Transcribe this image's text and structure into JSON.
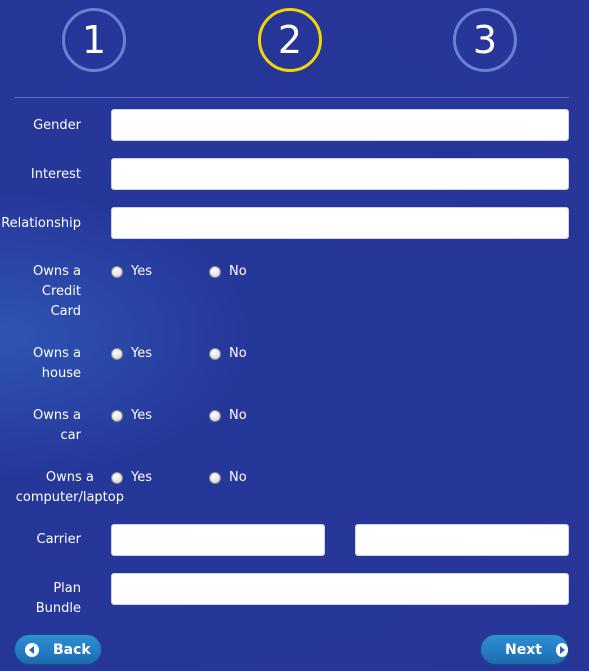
{
  "steps": [
    {
      "label": "1",
      "active": false
    },
    {
      "label": "2",
      "active": true
    },
    {
      "label": "3",
      "active": false
    }
  ],
  "colors": {
    "background": "#273597",
    "active_step": "#f2d600",
    "button": "#1c6bb0"
  },
  "form": {
    "gender": {
      "label": "Gender",
      "value": ""
    },
    "interest": {
      "label": "Interest",
      "value": ""
    },
    "relationship": {
      "label": "Relationship",
      "value": ""
    },
    "credit_card": {
      "label_lines": [
        "Owns a",
        "Credit",
        "Card"
      ],
      "yes": "Yes",
      "no": "No"
    },
    "house": {
      "label_lines": [
        "Owns a",
        "house"
      ],
      "yes": "Yes",
      "no": "No"
    },
    "car": {
      "label_lines": [
        "Owns a",
        "car"
      ],
      "yes": "Yes",
      "no": "No"
    },
    "computer": {
      "label_lines": [
        "Owns a",
        "computer/laptop"
      ],
      "yes": "Yes",
      "no": "No"
    },
    "carrier": {
      "label": "Carrier",
      "value_1": "",
      "value_2": ""
    },
    "plan_bundle": {
      "label_lines": [
        "Plan",
        "Bundle"
      ],
      "value": ""
    }
  },
  "buttons": {
    "back": "Back",
    "next": "Next"
  },
  "icons": {
    "back": "arrow-left-circle-icon",
    "next": "arrow-right-circle-icon"
  }
}
